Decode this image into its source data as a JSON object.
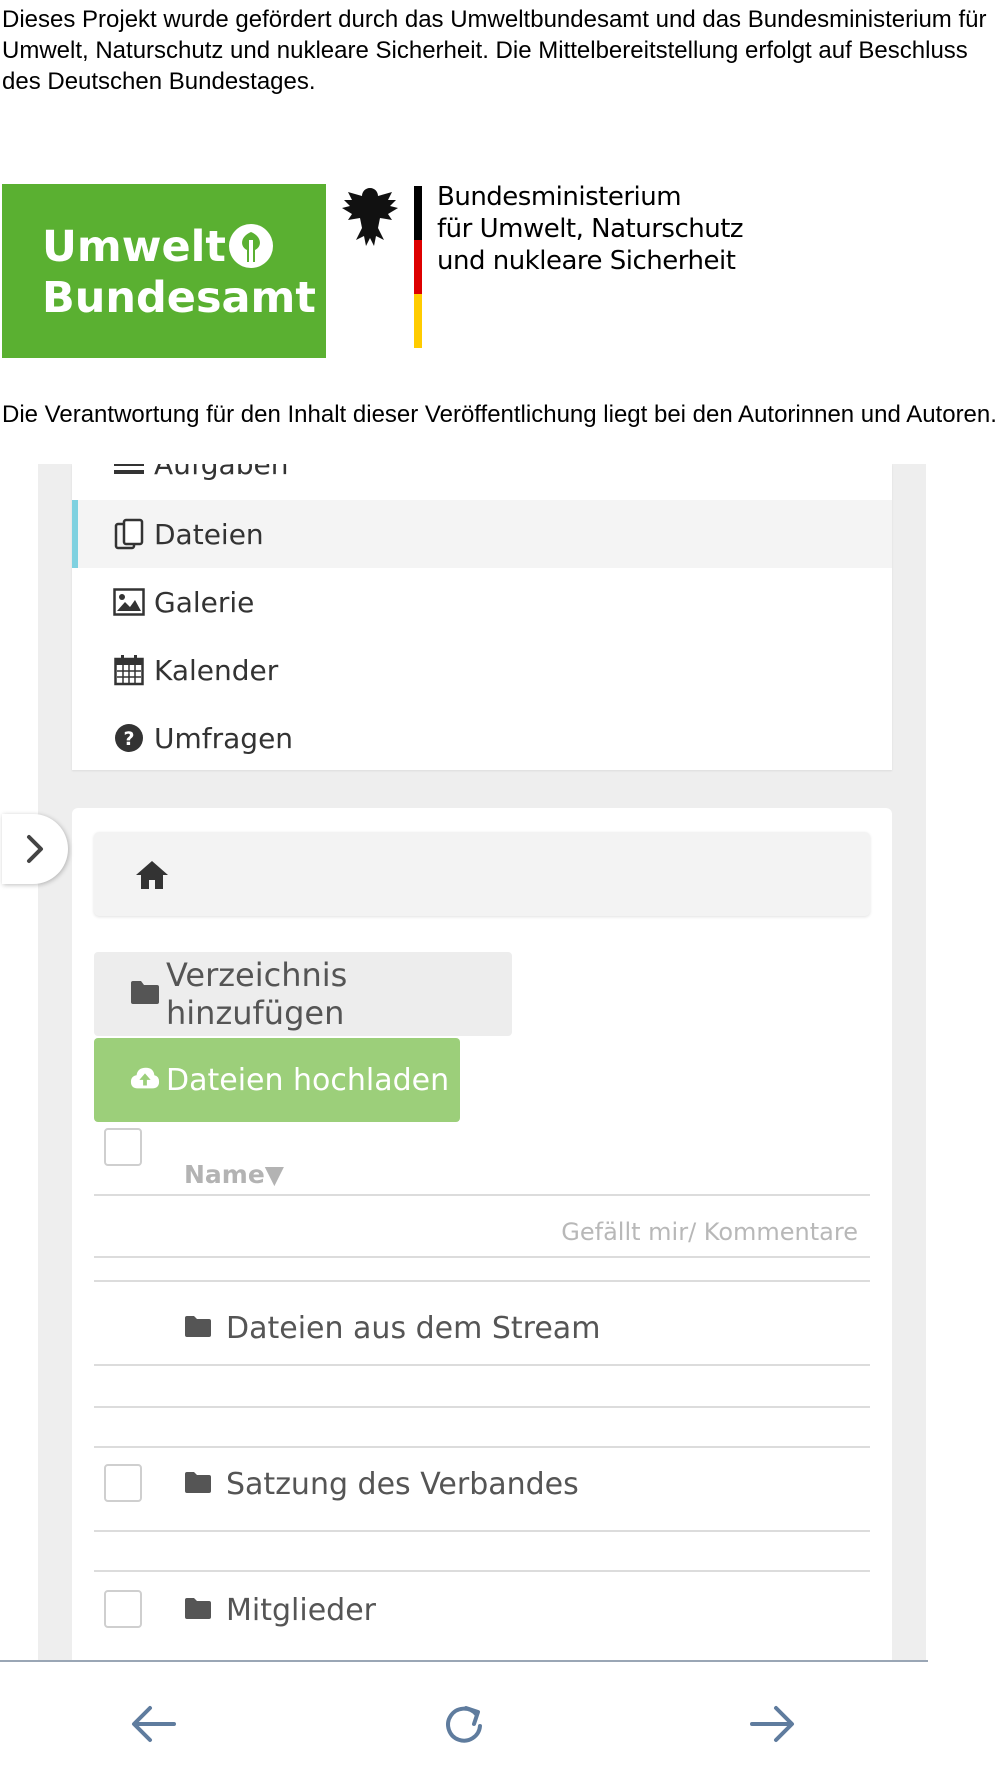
{
  "intro_text": "Dieses Projekt wurde gefördert durch das Umweltbundesamt und das Bundesministerium für Umwelt, Naturschutz und nukleare Sicherheit. Die Mittelbereitstellung erfolgt auf Beschluss des Deutschen Bundestages.",
  "logos": {
    "uba_line1": "Umwelt",
    "uba_line2": "Bundesamt",
    "bmu_line1": "Bundesministerium",
    "bmu_line2": "für Umwelt, Naturschutz",
    "bmu_line3": "und nukleare Sicherheit"
  },
  "responsibility_text": "Die Verantwortung für den Inhalt dieser Veröffentlichung liegt bei den Autorinnen und Autoren.",
  "menu": {
    "items": [
      {
        "label": "Aufgaben",
        "icon": "tasks-icon",
        "active": false
      },
      {
        "label": "Dateien",
        "icon": "files-icon",
        "active": true
      },
      {
        "label": "Galerie",
        "icon": "image-icon",
        "active": false
      },
      {
        "label": "Kalender",
        "icon": "calendar-icon",
        "active": false
      },
      {
        "label": "Umfragen",
        "icon": "question-circle-icon",
        "active": false
      }
    ]
  },
  "files": {
    "add_folder_label": "Verzeichnis hinzufügen",
    "upload_label": "Dateien hochladen",
    "name_header": "Name▼",
    "likes_header": "Gefällt mir/ Kommentare",
    "rows": [
      {
        "name": "Dateien aus dem Stream",
        "has_checkbox": false
      },
      {
        "name": "Satzung des Verbandes",
        "has_checkbox": true
      },
      {
        "name": "Mitglieder",
        "has_checkbox": true
      }
    ]
  },
  "colors": {
    "uba_green": "#5ab031",
    "upload_green": "#9ccf7a",
    "active_accent": "#7fd1e0",
    "nav_icon": "#5f7c9e"
  }
}
